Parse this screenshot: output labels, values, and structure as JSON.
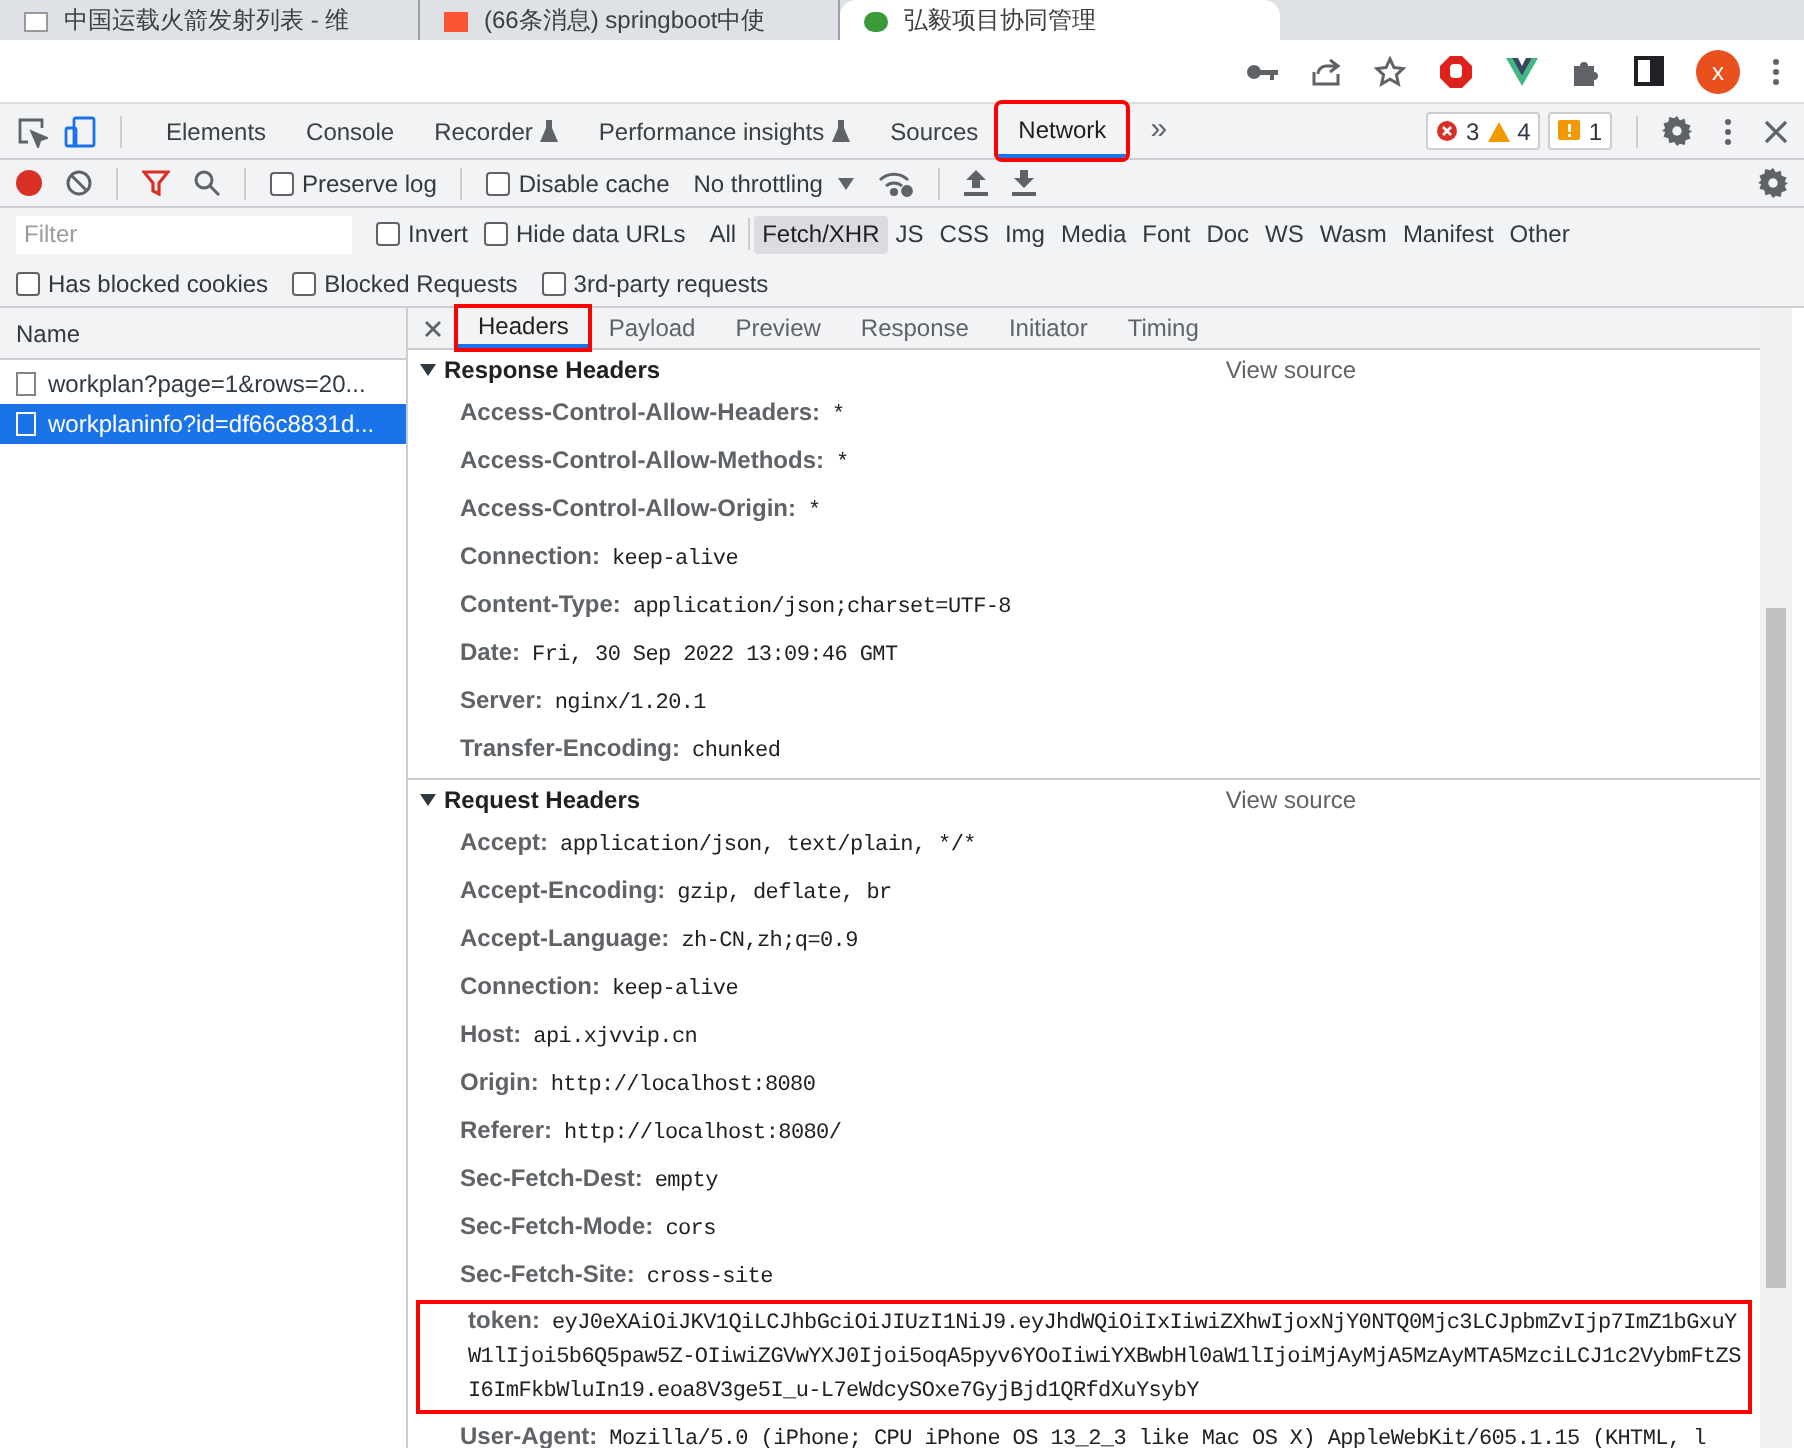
{
  "browser_tabs": [
    {
      "title": "中国运载火箭发射列表 - 维",
      "selected": false
    },
    {
      "title": "(66条消息) springboot中使",
      "selected": false
    },
    {
      "title": "弘毅项目协同管理",
      "selected": true
    }
  ],
  "profile": {
    "initial": "x"
  },
  "devtools_tabs": [
    {
      "label": "Elements",
      "selected": false,
      "flask": false,
      "highlighted": false
    },
    {
      "label": "Console",
      "selected": false,
      "flask": false,
      "highlighted": false
    },
    {
      "label": "Recorder",
      "selected": false,
      "flask": true,
      "highlighted": false
    },
    {
      "label": "Performance insights",
      "selected": false,
      "flask": true,
      "highlighted": false
    },
    {
      "label": "Sources",
      "selected": false,
      "flask": false,
      "highlighted": false
    },
    {
      "label": "Network",
      "selected": true,
      "flask": false,
      "highlighted": true
    }
  ],
  "more_tabs": "»",
  "counters": {
    "errors": "3",
    "warnings": "4",
    "issues": "1"
  },
  "toolbar": {
    "recording": true,
    "preserve_log": {
      "label": "Preserve log",
      "checked": false
    },
    "disable_cache": {
      "label": "Disable cache",
      "checked": false
    },
    "throttling": "No throttling"
  },
  "filter": {
    "placeholder": "Filter",
    "invert": {
      "label": "Invert",
      "checked": false
    },
    "hide_data_urls": {
      "label": "Hide data URLs",
      "checked": false
    },
    "types": [
      {
        "label": "All",
        "selected": false
      },
      {
        "label": "Fetch/XHR",
        "selected": true
      },
      {
        "label": "JS",
        "selected": false
      },
      {
        "label": "CSS",
        "selected": false
      },
      {
        "label": "Img",
        "selected": false
      },
      {
        "label": "Media",
        "selected": false
      },
      {
        "label": "Font",
        "selected": false
      },
      {
        "label": "Doc",
        "selected": false
      },
      {
        "label": "WS",
        "selected": false
      },
      {
        "label": "Wasm",
        "selected": false
      },
      {
        "label": "Manifest",
        "selected": false
      },
      {
        "label": "Other",
        "selected": false
      }
    ],
    "options": [
      {
        "label": "Has blocked cookies",
        "checked": false
      },
      {
        "label": "Blocked Requests",
        "checked": false
      },
      {
        "label": "3rd-party requests",
        "checked": false
      }
    ]
  },
  "requests": {
    "column": "Name",
    "rows": [
      {
        "name": "workplan?page=1&rows=20...",
        "selected": false
      },
      {
        "name": "workplaninfo?id=df66c8831d...",
        "selected": true
      }
    ]
  },
  "detail_tabs": [
    {
      "label": "Headers",
      "selected": true,
      "highlighted": true
    },
    {
      "label": "Payload",
      "selected": false,
      "highlighted": false
    },
    {
      "label": "Preview",
      "selected": false,
      "highlighted": false
    },
    {
      "label": "Response",
      "selected": false,
      "highlighted": false
    },
    {
      "label": "Initiator",
      "selected": false,
      "highlighted": false
    },
    {
      "label": "Timing",
      "selected": false,
      "highlighted": false
    }
  ],
  "sections": [
    {
      "title": "Response Headers",
      "expanded": true,
      "link": "View source",
      "headers": [
        {
          "name": "Access-Control-Allow-Headers:",
          "value": "*",
          "highlighted": false
        },
        {
          "name": "Access-Control-Allow-Methods:",
          "value": "*",
          "highlighted": false
        },
        {
          "name": "Access-Control-Allow-Origin:",
          "value": "*",
          "highlighted": false
        },
        {
          "name": "Connection:",
          "value": "keep-alive",
          "highlighted": false
        },
        {
          "name": "Content-Type:",
          "value": "application/json;charset=UTF-8",
          "highlighted": false
        },
        {
          "name": "Date:",
          "value": "Fri, 30 Sep 2022 13:09:46 GMT",
          "highlighted": false
        },
        {
          "name": "Server:",
          "value": "nginx/1.20.1",
          "highlighted": false
        },
        {
          "name": "Transfer-Encoding:",
          "value": "chunked",
          "highlighted": false
        }
      ]
    },
    {
      "title": "Request Headers",
      "expanded": true,
      "link": "View source",
      "headers": [
        {
          "name": "Accept:",
          "value": "application/json, text/plain, */*",
          "highlighted": false
        },
        {
          "name": "Accept-Encoding:",
          "value": "gzip, deflate, br",
          "highlighted": false
        },
        {
          "name": "Accept-Language:",
          "value": "zh-CN,zh;q=0.9",
          "highlighted": false
        },
        {
          "name": "Connection:",
          "value": "keep-alive",
          "highlighted": false
        },
        {
          "name": "Host:",
          "value": "api.xjvvip.cn",
          "highlighted": false
        },
        {
          "name": "Origin:",
          "value": "http://localhost:8080",
          "highlighted": false
        },
        {
          "name": "Referer:",
          "value": "http://localhost:8080/",
          "highlighted": false
        },
        {
          "name": "Sec-Fetch-Dest:",
          "value": "empty",
          "highlighted": false
        },
        {
          "name": "Sec-Fetch-Mode:",
          "value": "cors",
          "highlighted": false
        },
        {
          "name": "Sec-Fetch-Site:",
          "value": "cross-site",
          "highlighted": false
        },
        {
          "name": "token:",
          "value": "eyJ0eXAiOiJKV1QiLCJhbGciOiJIUzI1NiJ9.eyJhdWQiOiIxIiwiZXhwIjoxNjY0NTQ0Mjc3LCJpbmZvIjp7ImZ1bGxuYW1lIjoi5b6Q5paw5Z-OIiwiZGVwYXJ0Ijoi5oqA5pyv6YOoIiwiYXBwbHl0aW1lIjoiMjAyMjA5MzAyMTA5MzciLCJ1c2VybmFtZSI6ImFkbWluIn19.eoa8V3ge5I_u-L7eWdcySOxe7GyjBjd1QRfdXuYsybY",
          "highlighted": true
        },
        {
          "name": "User-Agent:",
          "value": "Mozilla/5.0 (iPhone; CPU iPhone OS 13_2_3 like Mac OS X) AppleWebKit/605.1.15 (KHTML, l",
          "highlighted": false
        }
      ]
    }
  ]
}
